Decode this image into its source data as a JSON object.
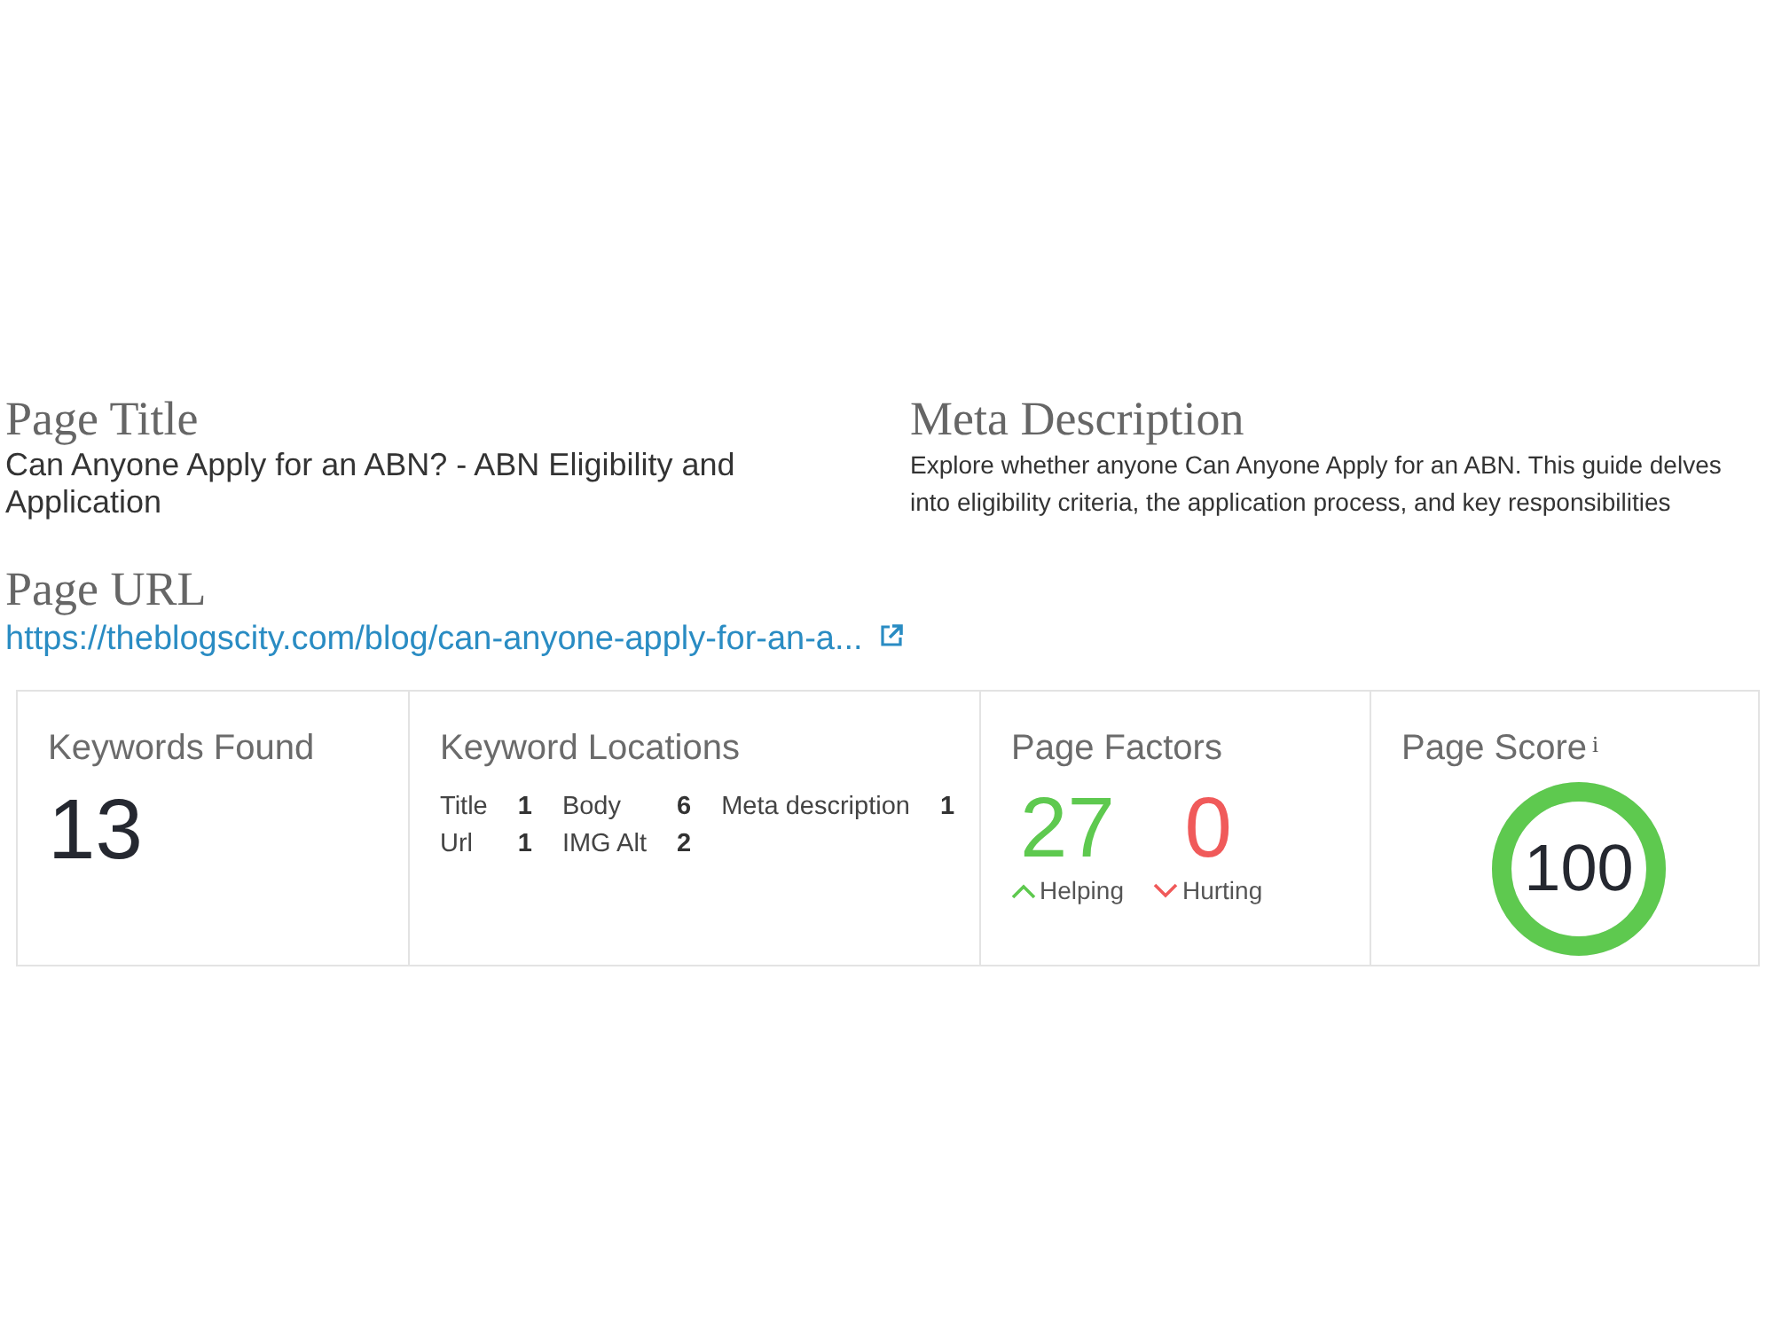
{
  "page_title": {
    "heading": "Page Title",
    "text": "Can Anyone Apply for an ABN? - ABN Eligibility and Application"
  },
  "meta_description": {
    "heading": "Meta Description",
    "text": "Explore whether anyone Can Anyone Apply for an ABN. This guide delves into eligibility criteria, the application process, and key responsibilities"
  },
  "page_url": {
    "heading": "Page URL",
    "link": "https://theblogscity.com/blog/can-anyone-apply-for-an-a..."
  },
  "stats": {
    "keywords_found": {
      "heading": "Keywords Found",
      "value": "13"
    },
    "keyword_locations": {
      "heading": "Keyword Locations",
      "items": [
        {
          "label": "Title",
          "count": "1"
        },
        {
          "label": "Body",
          "count": "6"
        },
        {
          "label": "Meta description",
          "count": "1"
        },
        {
          "label": "Url",
          "count": "1"
        },
        {
          "label": "IMG Alt",
          "count": "2"
        }
      ]
    },
    "page_factors": {
      "heading": "Page Factors",
      "items": [
        {
          "kind": "helping",
          "value": "27",
          "label": "Helping"
        },
        {
          "kind": "hurting",
          "value": "0",
          "label": "Hurting"
        }
      ]
    },
    "page_score": {
      "heading": "Page Score",
      "info": "i",
      "value": "100",
      "level": 1
    }
  }
}
